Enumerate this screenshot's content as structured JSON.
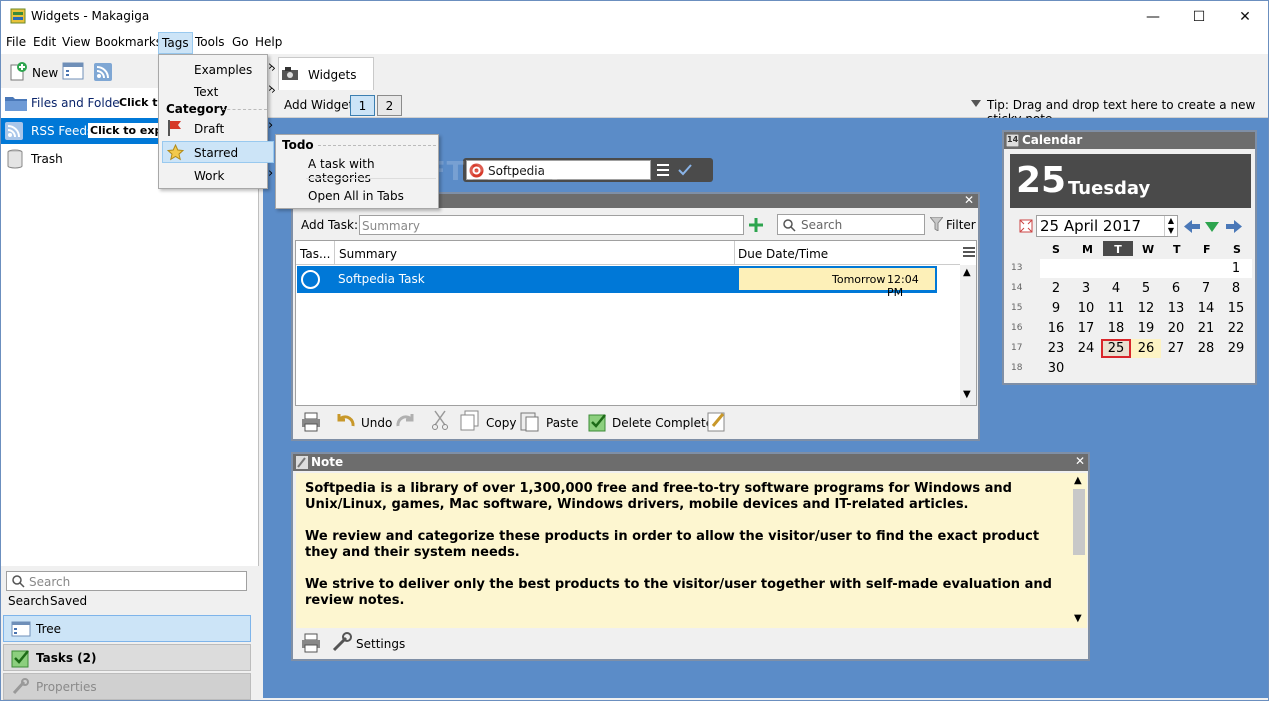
{
  "window": {
    "title": "Widgets - Makagiga",
    "min_label": "—",
    "max_label": "☐",
    "close_label": "✕"
  },
  "menubar": [
    "File",
    "Edit",
    "View",
    "Bookmarks",
    "Tags",
    "Tools",
    "Go",
    "Help"
  ],
  "sidebar": {
    "new_label": "New",
    "items": [
      {
        "label": "Files and Folders",
        "hint": "Click to expa"
      },
      {
        "label": "RSS Feeds",
        "hint": "Click to expan"
      },
      {
        "label": "Trash",
        "hint": ""
      }
    ],
    "search_placeholder": "Search",
    "search_tabs": [
      "Search",
      "Saved"
    ],
    "bottom_tabs": [
      {
        "label": "Tree"
      },
      {
        "label": "Tasks (2)"
      },
      {
        "label": "Properties"
      }
    ]
  },
  "tags_menu": {
    "items_top": [
      "Examples",
      "Text"
    ],
    "category_header": "Category",
    "items_category": [
      "Draft",
      "Starred",
      "Work"
    ]
  },
  "submenu": {
    "header": "Todo",
    "item1": "A task with categories",
    "item2": "Open All in Tabs"
  },
  "tab": {
    "label": "Widgets"
  },
  "widgetbar": {
    "add_label": "Add Widget",
    "pages": [
      "1",
      "2"
    ],
    "tip": "Tip: Drag and drop text here to create a new sticky note"
  },
  "softpedia_widget": {
    "value": "Softpedia",
    "watermark": "SOFTPEDIA"
  },
  "todo": {
    "add_task_label": "Add Task:",
    "summary_placeholder": "Summary",
    "search_placeholder": "Search",
    "filter_label": "Filter",
    "columns": [
      "Tas...",
      "Summary",
      "Due Date/Time"
    ],
    "rows": [
      {
        "summary": "Softpedia Task",
        "due": "Tomorrow",
        "time": "12:04 PM"
      }
    ],
    "footer": {
      "undo": "Undo",
      "copy": "Copy",
      "paste": "Paste",
      "delete_completed": "Delete Completed"
    }
  },
  "calendar": {
    "title": "Calendar",
    "icon_day": "14",
    "big_day": "25",
    "big_weekday": "Tuesday",
    "date_value": "25 April 2017",
    "weekdays": [
      "S",
      "M",
      "T",
      "W",
      "T",
      "F",
      "S"
    ],
    "weeks": [
      {
        "wk": "13",
        "days": [
          "",
          "",
          "",
          "",
          "",
          "",
          "1"
        ]
      },
      {
        "wk": "14",
        "days": [
          "2",
          "3",
          "4",
          "5",
          "6",
          "7",
          "8"
        ]
      },
      {
        "wk": "15",
        "days": [
          "9",
          "10",
          "11",
          "12",
          "13",
          "14",
          "15"
        ]
      },
      {
        "wk": "16",
        "days": [
          "16",
          "17",
          "18",
          "19",
          "20",
          "21",
          "22"
        ]
      },
      {
        "wk": "17",
        "days": [
          "23",
          "24",
          "25",
          "26",
          "27",
          "28",
          "29"
        ]
      },
      {
        "wk": "18",
        "days": [
          "30",
          "",
          "",
          "",
          "",
          "",
          ""
        ]
      }
    ],
    "today": "25",
    "highlight": "26"
  },
  "note": {
    "title": "Note",
    "paragraphs": [
      "Softpedia is a library of over 1,300,000 free and free-to-try software programs for Windows and Unix/Linux, games, Mac software, Windows drivers, mobile devices and IT-related articles.",
      "We review and categorize these products in order to allow the visitor/user to find the exact product they and their system needs.",
      "We strive to deliver only the best products to the visitor/user together with self-made evaluation and review notes."
    ],
    "settings_label": "Settings"
  },
  "colors": {
    "accent": "#0078d7",
    "desk": "#5b8cc8",
    "note_bg": "#fdf6d0",
    "today_border": "#d9262b"
  }
}
